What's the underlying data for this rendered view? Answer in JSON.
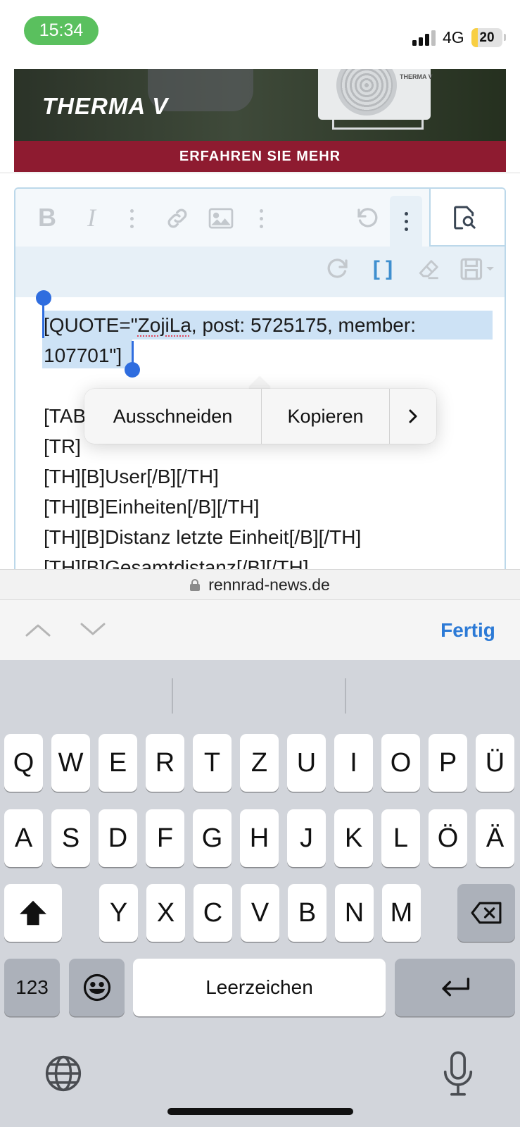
{
  "status": {
    "time": "15:34",
    "network": "4G",
    "battery": "20",
    "battery_level": 0.2
  },
  "ad": {
    "brand": "THERMA V",
    "unit_label": "THERMA V",
    "cta": "ERFAHREN SIE MEHR"
  },
  "toolbar": {
    "bold": "B",
    "italic": "I",
    "bbcode": "[ ]"
  },
  "editor": {
    "lines": [
      {
        "parts": [
          "[QUOTE=\"",
          "ZojiLa",
          ", post: 5725175, member:"
        ]
      },
      "107701\"]",
      "",
      "[TABLE]",
      "[TR]",
      "[TH][B]User[/B][/TH]",
      "[TH][B]Einheiten[/B][/TH]",
      "[TH][B]Distanz letzte Einheit[/B][/TH]",
      "[TH][B]Gesamtdistanz[/B][/TH]"
    ]
  },
  "context_menu": {
    "cut": "Ausschneiden",
    "copy": "Kopieren",
    "more": "›"
  },
  "url": "rennrad-news.de",
  "form_nav": {
    "done": "Fertig"
  },
  "keyboard": {
    "row1": [
      "Q",
      "W",
      "E",
      "R",
      "T",
      "Z",
      "U",
      "I",
      "O",
      "P",
      "Ü"
    ],
    "row2": [
      "A",
      "S",
      "D",
      "F",
      "G",
      "H",
      "J",
      "K",
      "L",
      "Ö",
      "Ä"
    ],
    "row3": [
      "Y",
      "X",
      "C",
      "V",
      "B",
      "N",
      "M"
    ],
    "numbers": "123",
    "space": "Leerzeichen"
  }
}
